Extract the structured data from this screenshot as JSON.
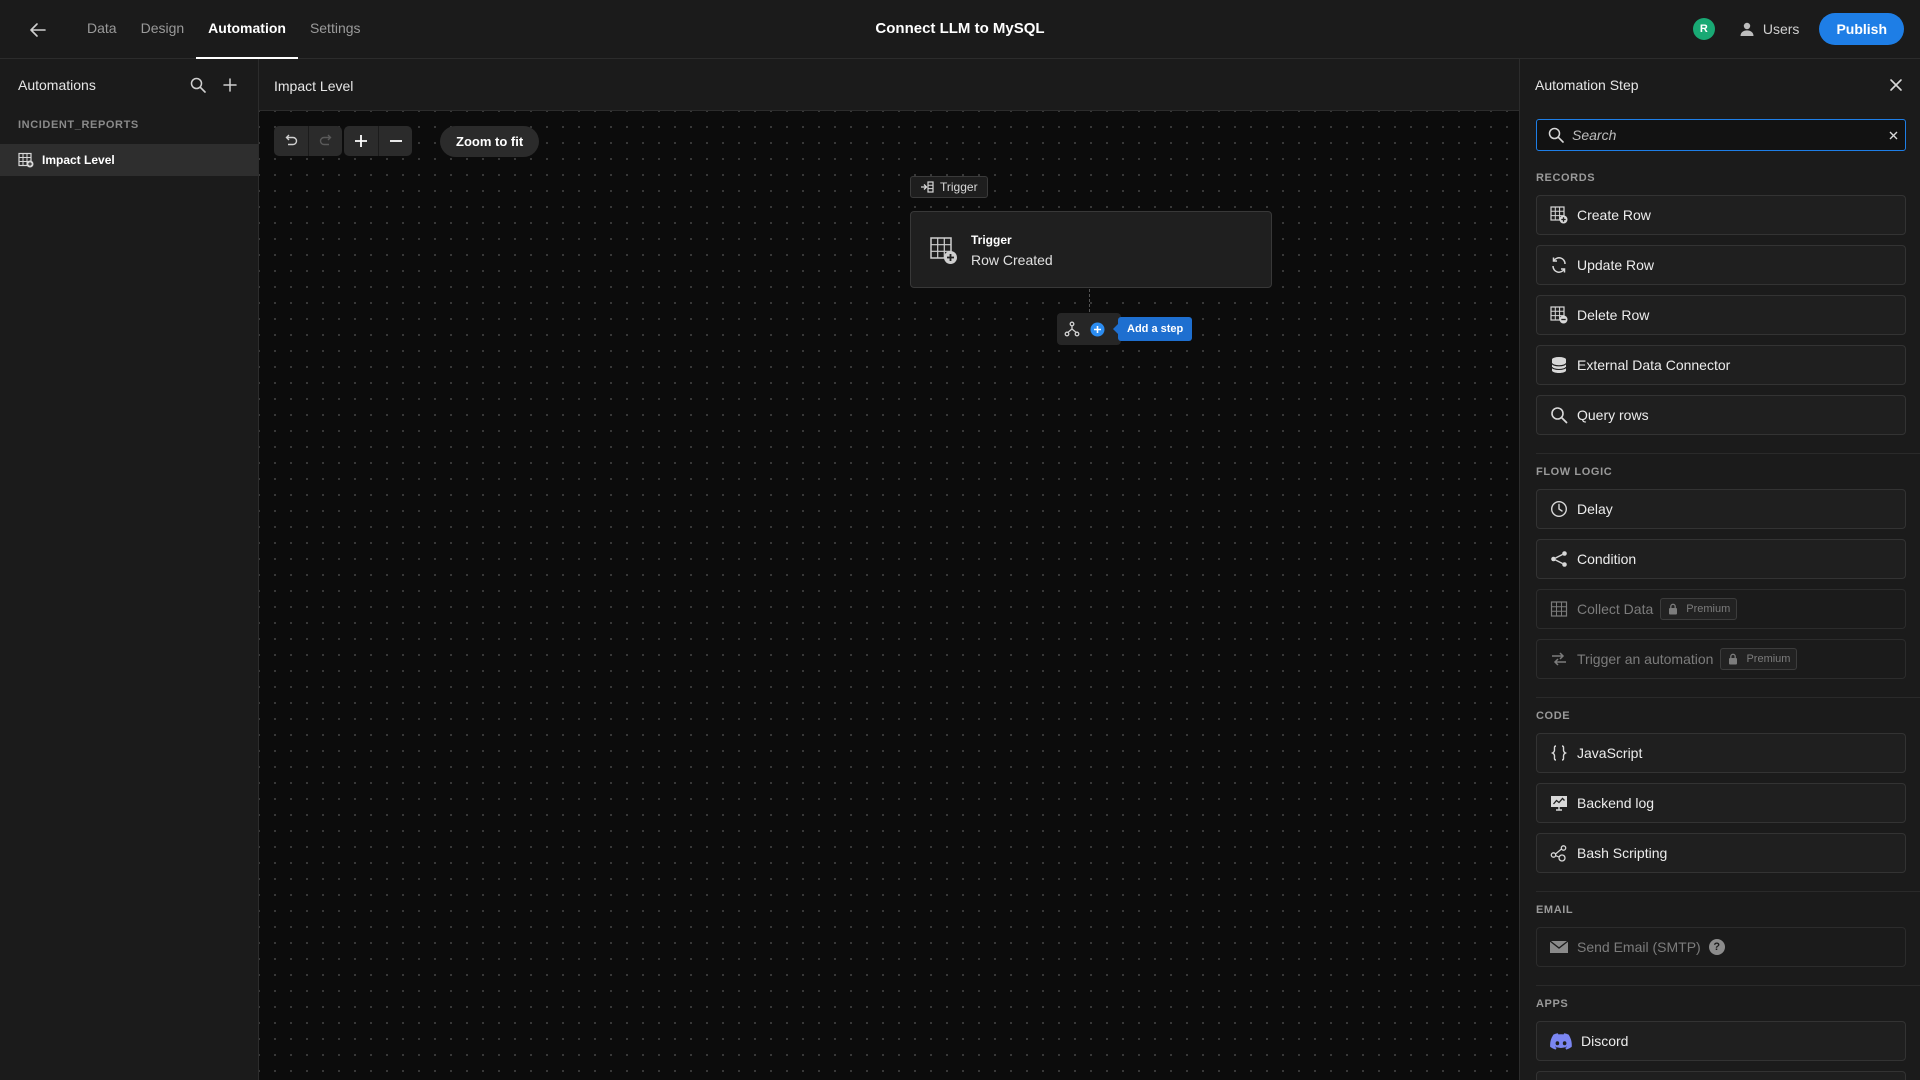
{
  "app": {
    "title": "Connect LLM to MySQL"
  },
  "nav": {
    "tabs": [
      {
        "label": "Data"
      },
      {
        "label": "Design"
      },
      {
        "label": "Automation"
      },
      {
        "label": "Settings"
      }
    ]
  },
  "header": {
    "avatar_initial": "R",
    "users_label": "Users",
    "publish_label": "Publish"
  },
  "sidebar": {
    "title": "Automations",
    "section": "INCIDENT_REPORTS",
    "items": [
      {
        "label": "Impact Level"
      }
    ]
  },
  "canvas": {
    "title": "Impact Level",
    "zoom_to_fit": "Zoom to fit",
    "trigger_tag": "Trigger",
    "trigger_card": {
      "title": "Trigger",
      "subtitle": "Row Created"
    },
    "add_step": "Add a step"
  },
  "panel": {
    "title": "Automation Step",
    "search_placeholder": "Search",
    "groups": {
      "records": {
        "label": "RECORDS",
        "items": [
          {
            "label": "Create Row",
            "icon": "table-add-icon"
          },
          {
            "label": "Update Row",
            "icon": "refresh-icon"
          },
          {
            "label": "Delete Row",
            "icon": "table-remove-icon"
          },
          {
            "label": "External Data Connector",
            "icon": "database-icon"
          },
          {
            "label": "Query rows",
            "icon": "search-icon"
          }
        ]
      },
      "flow": {
        "label": "FLOW LOGIC",
        "items": [
          {
            "label": "Delay",
            "icon": "clock-icon"
          },
          {
            "label": "Condition",
            "icon": "share-icon"
          },
          {
            "label": "Collect Data",
            "icon": "grid-icon",
            "badge": "Premium"
          },
          {
            "label": "Trigger an automation",
            "icon": "swap-icon",
            "badge": "Premium"
          }
        ]
      },
      "code": {
        "label": "CODE",
        "items": [
          {
            "label": "JavaScript",
            "icon": "braces-icon"
          },
          {
            "label": "Backend log",
            "icon": "monitor-icon"
          },
          {
            "label": "Bash Scripting",
            "icon": "nodes-icon"
          }
        ]
      },
      "email": {
        "label": "EMAIL",
        "items": [
          {
            "label": "Send Email (SMTP)",
            "icon": "mail-icon",
            "help": "?"
          }
        ]
      },
      "apps": {
        "label": "APPS",
        "items": [
          {
            "label": "Discord",
            "icon": "discord-icon"
          }
        ]
      }
    }
  },
  "colors": {
    "accent": "#1e7ee6",
    "avatar": "#19a974",
    "background": "#0c0c0c",
    "panel": "#1b1b1b"
  }
}
